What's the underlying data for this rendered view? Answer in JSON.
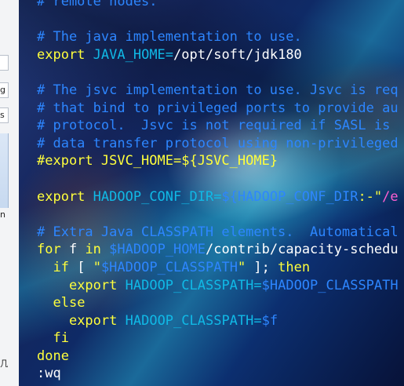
{
  "left_panel": {
    "labels": [
      "g",
      "s",
      "n",
      "几"
    ]
  },
  "editor": {
    "lines": [
      [
        {
          "t": "# remote nodes.",
          "c": "c"
        }
      ],
      [
        {
          "t": "",
          "c": "w"
        }
      ],
      [
        {
          "t": "# The java implementation to use.",
          "c": "c"
        }
      ],
      [
        {
          "t": "export",
          "c": "k"
        },
        {
          "t": " ",
          "c": "w"
        },
        {
          "t": "JAVA_HOME=",
          "c": "v"
        },
        {
          "t": "/opt/soft/jdk180",
          "c": "w"
        }
      ],
      [
        {
          "t": "",
          "c": "w"
        }
      ],
      [
        {
          "t": "# The jsvc implementation to use. Jsvc is req",
          "c": "c"
        }
      ],
      [
        {
          "t": "# that bind to privileged ports to provide au",
          "c": "c"
        }
      ],
      [
        {
          "t": "# protocol.  Jsvc is not required if SASL is ",
          "c": "c"
        }
      ],
      [
        {
          "t": "# data transfer protocol using non-privileged",
          "c": "c"
        }
      ],
      [
        {
          "t": "#export JSVC_HOME=${JSVC_HOME}",
          "c": "k"
        }
      ],
      [
        {
          "t": "",
          "c": "w"
        }
      ],
      [
        {
          "t": "export",
          "c": "k"
        },
        {
          "t": " ",
          "c": "w"
        },
        {
          "t": "HADOOP_CONF_DIR=",
          "c": "v"
        },
        {
          "t": "${HADOOP_CONF_DIR",
          "c": "c"
        },
        {
          "t": ":-\"",
          "c": "k"
        },
        {
          "t": "/e",
          "c": "m"
        }
      ],
      [
        {
          "t": "",
          "c": "w"
        }
      ],
      [
        {
          "t": "# Extra Java CLASSPATH elements.  Automatical",
          "c": "c"
        }
      ],
      [
        {
          "t": "for",
          "c": "k"
        },
        {
          "t": " f ",
          "c": "w"
        },
        {
          "t": "in",
          "c": "k"
        },
        {
          "t": " ",
          "c": "w"
        },
        {
          "t": "$HADOOP_HOME",
          "c": "c"
        },
        {
          "t": "/contrib/capacity-schedu",
          "c": "w"
        }
      ],
      [
        {
          "t": "  ",
          "c": "w"
        },
        {
          "t": "if",
          "c": "k"
        },
        {
          "t": " [ ",
          "c": "w"
        },
        {
          "t": "\"",
          "c": "k"
        },
        {
          "t": "$HADOOP_CLASSPATH",
          "c": "c"
        },
        {
          "t": "\"",
          "c": "k"
        },
        {
          "t": " ]; ",
          "c": "w"
        },
        {
          "t": "then",
          "c": "k"
        }
      ],
      [
        {
          "t": "    ",
          "c": "w"
        },
        {
          "t": "export",
          "c": "k"
        },
        {
          "t": " ",
          "c": "w"
        },
        {
          "t": "HADOOP_CLASSPATH=",
          "c": "v"
        },
        {
          "t": "$HADOOP_CLASSPATH",
          "c": "c"
        }
      ],
      [
        {
          "t": "  ",
          "c": "w"
        },
        {
          "t": "else",
          "c": "k"
        }
      ],
      [
        {
          "t": "    ",
          "c": "w"
        },
        {
          "t": "export",
          "c": "k"
        },
        {
          "t": " ",
          "c": "w"
        },
        {
          "t": "HADOOP_CLASSPATH=",
          "c": "v"
        },
        {
          "t": "$f",
          "c": "c"
        }
      ],
      [
        {
          "t": "  ",
          "c": "w"
        },
        {
          "t": "fi",
          "c": "k"
        }
      ],
      [
        {
          "t": "done",
          "c": "k"
        }
      ],
      [
        {
          "t": ":wq",
          "c": "w"
        }
      ]
    ]
  }
}
